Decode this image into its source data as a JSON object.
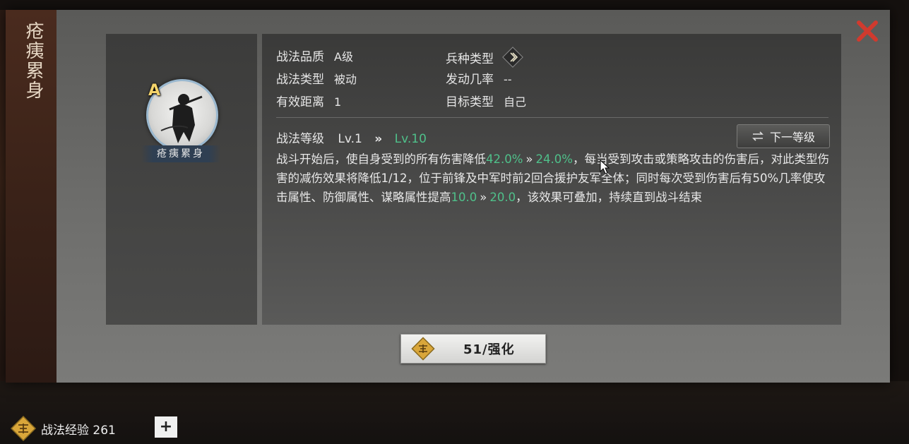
{
  "skill": {
    "name": "疮痍累身",
    "grade_badge": "A"
  },
  "info": {
    "quality_label": "战法品质",
    "quality_value": "A级",
    "type_label": "战法类型",
    "type_value": "被动",
    "range_label": "有效距离",
    "range_value": "1",
    "troop_label": "兵种类型",
    "rate_label": "发动几率",
    "rate_value": "--",
    "target_label": "目标类型",
    "target_value": "自己"
  },
  "level": {
    "label": "战法等级",
    "current": "Lv.1",
    "arrow": "»",
    "max": "Lv.10",
    "next_button": "下一等级"
  },
  "description": {
    "p1": "战斗开始后，使自身受到的所有伤害降低",
    "v1a": "42.0%",
    "v1b": "24.0%",
    "p2": "，每当受到攻击或策略攻击的伤害后，对此类型伤害的减伤效果将降低1/12，位于前锋及中军时前2回合援护友军全体；同时每次受到伤害后有50%几率使攻击属性、防御属性、谋略属性提高",
    "v2a": "10.0",
    "v2b": "20.0",
    "p3": "，该效果可叠加，持续直到战斗结束",
    "arrow": "»"
  },
  "upgrade_button": "51/强化",
  "footer": {
    "exp_label": "战法经验 261",
    "plus": "+"
  },
  "icons": {
    "close": "close-icon",
    "troop": "troop-type-icon",
    "swap": "swap-icon",
    "exp": "exp-token-icon"
  },
  "colors": {
    "accent_green": "#4fc08a",
    "close_red": "#d03a2e",
    "badge_gold": "#f3d36a"
  }
}
